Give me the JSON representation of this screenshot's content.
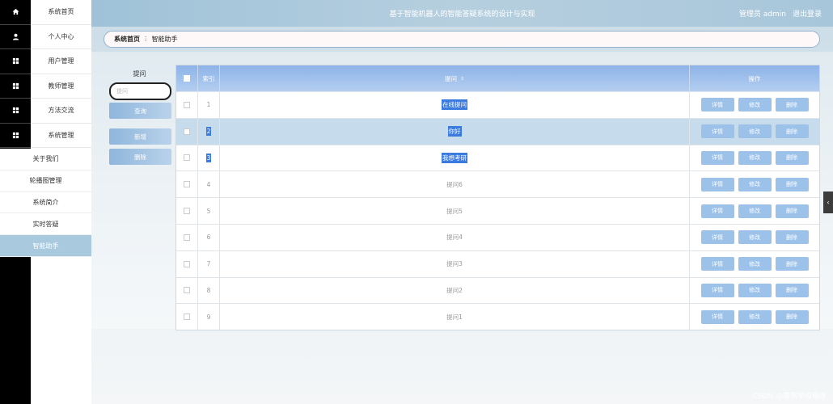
{
  "header": {
    "title": "基于智能机器人的智能答疑系统的设计与实现",
    "user": "管理员 admin",
    "logout": "退出登录"
  },
  "nav": {
    "icons": [
      "home-icon",
      "user-icon",
      "grid-icon",
      "grid-icon",
      "grid-icon",
      "grid-icon"
    ],
    "items": [
      {
        "label": "系统首页"
      },
      {
        "label": "个人中心"
      },
      {
        "label": "用户管理"
      },
      {
        "label": "教师管理"
      },
      {
        "label": "方法交流"
      },
      {
        "label": "系统管理"
      }
    ],
    "submenu": [
      {
        "label": "关于我们"
      },
      {
        "label": "轮播图管理"
      },
      {
        "label": "系统简介"
      },
      {
        "label": "实时答疑"
      },
      {
        "label": "智能助手",
        "active": true
      }
    ]
  },
  "breadcrumb": {
    "home": "系统首页",
    "separator": "ⵗ",
    "current": "智能助手"
  },
  "search": {
    "label": "提问",
    "placeholder": "提问",
    "query_button": "查询",
    "add_button": "新增",
    "delete_button": "删除"
  },
  "table": {
    "headers": {
      "index": "索引",
      "question": "提问",
      "actions": "操作"
    },
    "actions": {
      "detail": "详情",
      "edit": "修改",
      "delete": "删除"
    },
    "rows": [
      {
        "index": "1",
        "question": "在线提问",
        "highlight": false,
        "selected_text": true
      },
      {
        "index": "2",
        "question": "你好",
        "highlight": true,
        "selected_text": true
      },
      {
        "index": "3",
        "question": "我想考研",
        "highlight": false,
        "selected_text": true
      },
      {
        "index": "4",
        "question": "提问6",
        "highlight": false,
        "selected_text": false
      },
      {
        "index": "5",
        "question": "提问5",
        "highlight": false,
        "selected_text": false
      },
      {
        "index": "6",
        "question": "提问4",
        "highlight": false,
        "selected_text": false
      },
      {
        "index": "7",
        "question": "提问3",
        "highlight": false,
        "selected_text": false
      },
      {
        "index": "8",
        "question": "提问2",
        "highlight": false,
        "selected_text": false
      },
      {
        "index": "9",
        "question": "提问1",
        "highlight": false,
        "selected_text": false
      }
    ]
  },
  "side_handle": "‹",
  "watermark": "CSDN @基努毕设程序",
  "colors": {
    "header": "#a9c6da",
    "accent": "#8db3e8",
    "button": "#9cc2ea",
    "active_menu": "#a9c9de"
  }
}
